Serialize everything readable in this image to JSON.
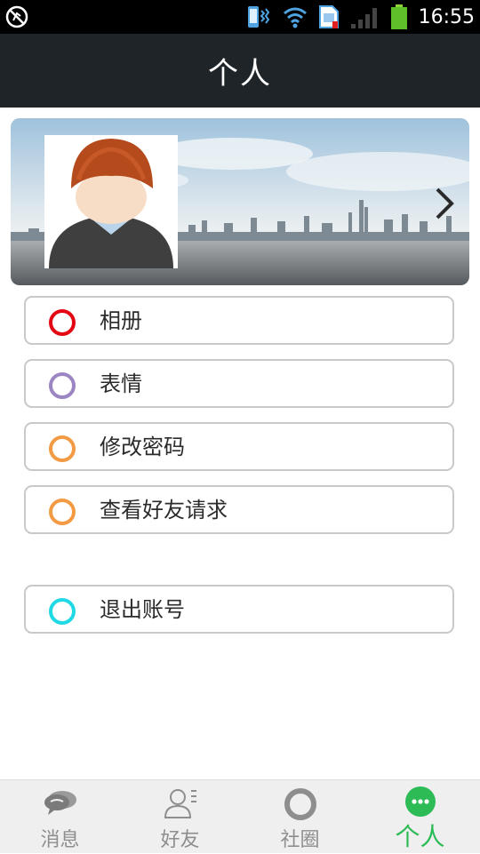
{
  "status_bar": {
    "time": "16:55"
  },
  "title_bar": {
    "title": "个人"
  },
  "menu": {
    "items": [
      {
        "label": "相册",
        "color": "#e30613"
      },
      {
        "label": "表情",
        "color": "#9b85c2"
      },
      {
        "label": "修改密码",
        "color": "#f39a44"
      },
      {
        "label": "查看好友请求",
        "color": "#f39a44"
      }
    ],
    "logout": {
      "label": "退出账号",
      "color": "#21d9e5"
    }
  },
  "bottom_nav": {
    "tabs": [
      {
        "label": "消息",
        "icon": "chat-bubble-icon",
        "active": false
      },
      {
        "label": "好友",
        "icon": "contacts-icon",
        "active": false
      },
      {
        "label": "社圈",
        "icon": "circle-icon",
        "active": false
      },
      {
        "label": "个人",
        "icon": "more-dots-icon",
        "active": true
      }
    ],
    "active_color": "#2dbb56",
    "inactive_color": "#8e8e8e"
  }
}
